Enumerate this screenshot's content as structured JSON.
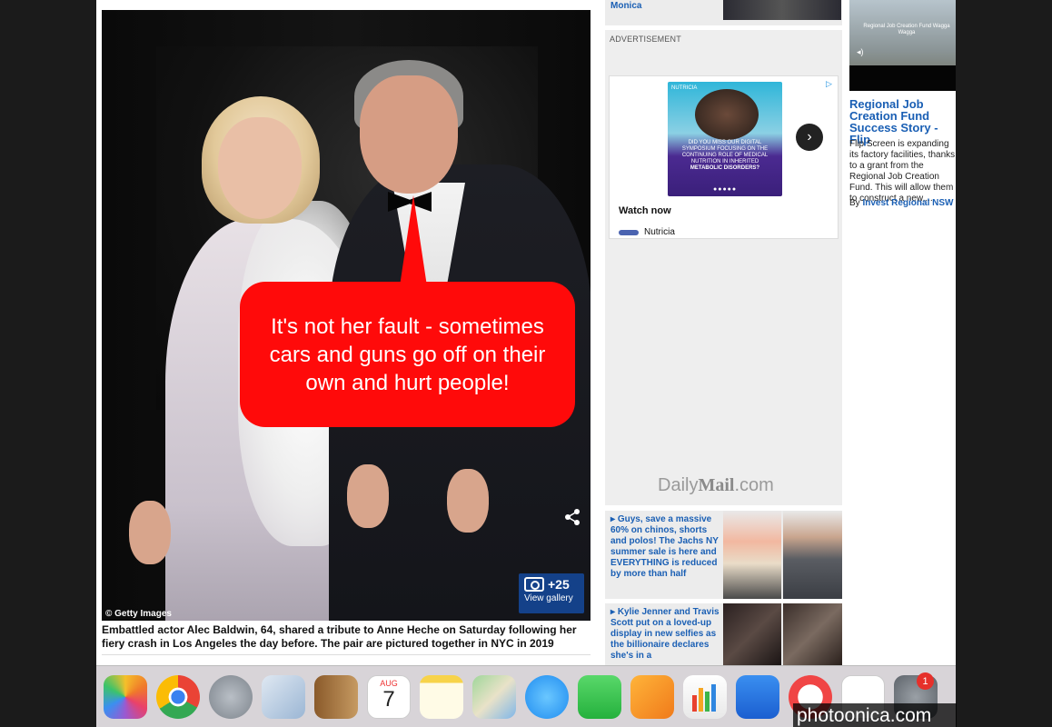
{
  "photo": {
    "credit": "© Getty Images",
    "callout": "It's not her fault - sometimes cars and guns go off on their own and hurt people!",
    "gallery_count": "+25",
    "gallery_label": "View gallery"
  },
  "caption": "Embattled actor Alec Baldwin, 64, shared a tribute to Anne Heche on Saturday following her fiery crash in Los Angeles the day before. The pair are pictured together in NYC in 2019",
  "rail": {
    "top_card_text": "Monica",
    "ad_label": "ADVERTISEMENT",
    "ad_brand": "NUTRICIA",
    "ad_message": "DID YOU MISS OUR DIGITAL SYMPOSIUM FOCUSING ON THE CONTINUING ROLE OF MEDICAL NUTRITION IN INHERITED",
    "ad_message_strong": "METABOLIC DISORDERS?",
    "ad_dots": "●●●●●",
    "ad_next": "›",
    "ad_watch": "Watch now",
    "ad_sponsor": "Nutricia",
    "logo_light": "Daily",
    "logo_bold": "Mail",
    "logo_suffix": ".com",
    "promos": [
      {
        "text": "Guys, save a massive 60% on chinos, shorts and polos! The Jachs NY summer sale is here and EVERYTHING is reduced by more than half"
      },
      {
        "text": "Kylie Jenner and Travis Scott put on a loved-up display in new selfies as the billionaire declares she's in a"
      }
    ]
  },
  "far": {
    "video_text": "Regional Job Creation Fund Wagga Wagga",
    "title": "Regional Job Creation Fund Success Story - Flip",
    "desc": "Flip Screen is expanding its factory facilities, thanks to a grant from the Regional Job Creation Fund. This will allow them to construct a new,...",
    "by_prefix": "By ",
    "by_name": "Invest Regional NSW"
  },
  "dock": {
    "items": [
      "photos-icon",
      "chrome-icon",
      "launchpad-icon",
      "mail-icon",
      "contacts-icon",
      "calendar-icon",
      "notes-icon",
      "maps-icon",
      "messages-icon",
      "facetime-icon",
      "pages-icon",
      "numbers-icon",
      "keynote-icon",
      "news-icon",
      "reminders-icon",
      "system-preferences-icon"
    ],
    "calendar_month": "AUG",
    "calendar_day": "7",
    "badge": "1"
  },
  "watermark": "photoonica.com",
  "colors": {
    "callout": "#ff0a0a",
    "link": "#1a5fb4",
    "gallery": "#1446a0"
  }
}
